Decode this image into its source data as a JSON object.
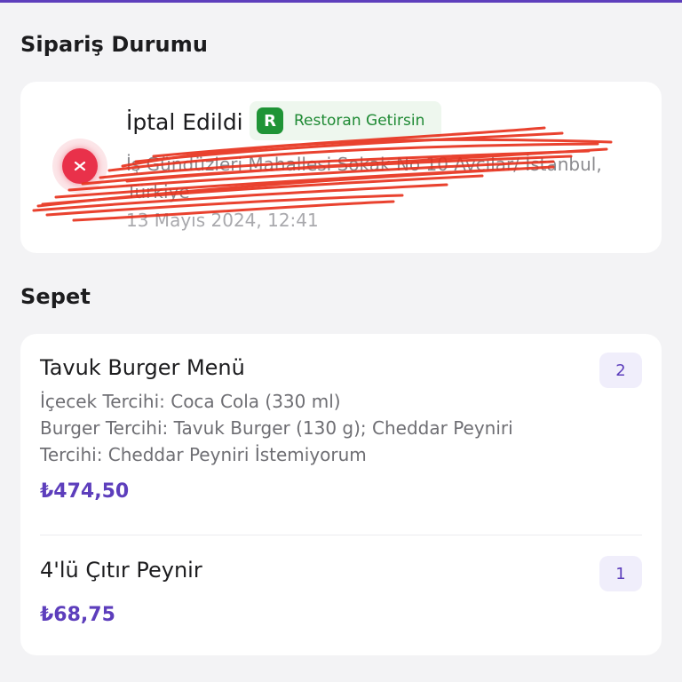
{
  "order_status": {
    "section_title": "Sipariş Durumu",
    "status": "İptal Edildi",
    "delivery_badge": {
      "letter": "R",
      "label": "Restoran Getirsin"
    },
    "address": "İş Gündüzleri Mahallesi Sokak No 10 Avcılar/ İstanbul, Türkiye",
    "date": "13 Mayıs 2024, 12:41",
    "status_icon": "cancel-x-icon"
  },
  "basket": {
    "section_title": "Sepet",
    "items": [
      {
        "name": "Tavuk Burger Menü",
        "options": [
          "İçecek Tercihi: Coca Cola (330 ml)",
          "Burger Tercihi: Tavuk Burger (130 g); Cheddar Peyniri",
          "Tercihi: Cheddar Peyniri İstemiyorum"
        ],
        "price": "₺474,50",
        "quantity": "2"
      },
      {
        "name": "4'lü Çıtır Peynir",
        "options": [],
        "price": "₺68,75",
        "quantity": "1"
      }
    ]
  },
  "colors": {
    "accent": "#5d3ebc",
    "cancel_red": "#e9314a",
    "badge_green": "#1f9436"
  }
}
